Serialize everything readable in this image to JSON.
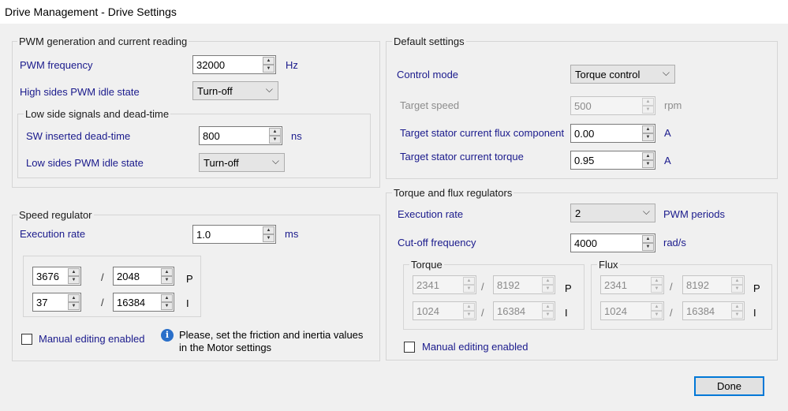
{
  "window": {
    "title": "Drive Management - Drive Settings"
  },
  "pwm": {
    "group_label": "PWM generation and current reading",
    "frequency_label": "PWM frequency",
    "frequency_value": "32000",
    "frequency_unit": "Hz",
    "high_idle_label": "High sides PWM idle state",
    "high_idle_value": "Turn-off",
    "lowside": {
      "group_label": "Low side signals and dead-time",
      "deadtime_label": "SW inserted dead-time",
      "deadtime_value": "800",
      "deadtime_unit": "ns",
      "low_idle_label": "Low sides PWM idle state",
      "low_idle_value": "Turn-off"
    }
  },
  "speed": {
    "group_label": "Speed regulator",
    "exec_label": "Execution rate",
    "exec_value": "1.0",
    "exec_unit": "ms",
    "p_num": "3676",
    "p_den": "2048",
    "p_label": "P",
    "i_num": "37",
    "i_den": "16384",
    "i_label": "I",
    "slash": "/",
    "manual_label": "Manual editing enabled",
    "note": "Please, set the friction and inertia values",
    "note2": "in the Motor settings"
  },
  "defaults": {
    "group_label": "Default settings",
    "control_label": "Control mode",
    "control_value": "Torque control",
    "speed_label": "Target speed",
    "speed_value": "500",
    "speed_unit": "rpm",
    "flux_label": "Target stator current flux component",
    "flux_value": "0.00",
    "flux_unit": "A",
    "torque_label": "Target stator current torque",
    "torque_value": "0.95",
    "torque_unit": "A"
  },
  "tfreg": {
    "group_label": "Torque and flux regulators",
    "exec_label": "Execution rate",
    "exec_value": "2",
    "exec_unit": "PWM periods",
    "cutoff_label": "Cut-off frequency",
    "cutoff_value": "4000",
    "cutoff_unit": "rad/s",
    "torque": {
      "group_label": "Torque",
      "p_num": "2341",
      "p_den": "8192",
      "p_label": "P",
      "i_num": "1024",
      "i_den": "16384",
      "i_label": "I"
    },
    "flux": {
      "group_label": "Flux",
      "p_num": "2341",
      "p_den": "8192",
      "p_label": "P",
      "i_num": "1024",
      "i_den": "16384",
      "i_label": "I"
    },
    "slash": "/",
    "manual_label": "Manual editing enabled"
  },
  "footer": {
    "done_label": "Done"
  },
  "icons": {
    "spin_up": "▲",
    "spin_down": "▼",
    "chevron": "⌵",
    "info": "i"
  }
}
